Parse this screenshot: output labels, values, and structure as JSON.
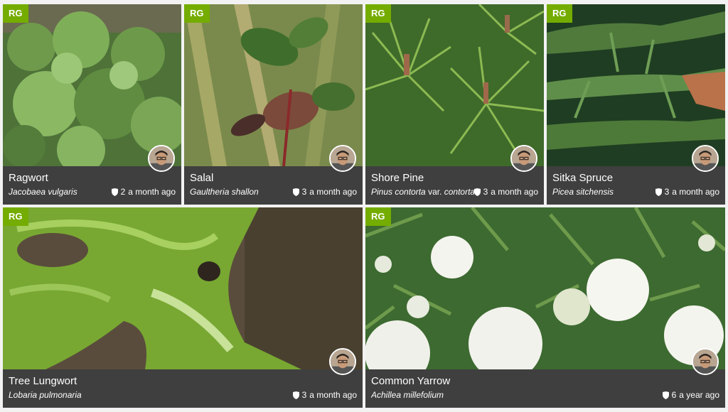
{
  "colors": {
    "badge_green": "#74ac00",
    "caption_bg": "#3f3f3f",
    "page_bg": "#f2f2f2"
  },
  "cards": [
    {
      "badge": "RG",
      "common_name": "Ragwort",
      "sci_genus_species": "Jacobaea vulgaris",
      "sci_variety_marker": "",
      "sci_variety": "",
      "id_count": "2",
      "age": "a month ago",
      "icon": "shield-icon"
    },
    {
      "badge": "RG",
      "common_name": "Salal",
      "sci_genus_species": "Gaultheria shallon",
      "sci_variety_marker": "",
      "sci_variety": "",
      "id_count": "3",
      "age": "a month ago",
      "icon": "shield-icon"
    },
    {
      "badge": "RG",
      "common_name": "Shore Pine",
      "sci_genus_species": "Pinus contorta",
      "sci_variety_marker": "var.",
      "sci_variety": "contorta",
      "id_count": "3",
      "age": "a month ago",
      "icon": "shield-icon"
    },
    {
      "badge": "RG",
      "common_name": "Sitka Spruce",
      "sci_genus_species": "Picea sitchensis",
      "sci_variety_marker": "",
      "sci_variety": "",
      "id_count": "3",
      "age": "a month ago",
      "icon": "shield-icon"
    },
    {
      "badge": "RG",
      "common_name": "Tree Lungwort",
      "sci_genus_species": "Lobaria pulmonaria",
      "sci_variety_marker": "",
      "sci_variety": "",
      "id_count": "3",
      "age": "a month ago",
      "icon": "shield-icon"
    },
    {
      "badge": "RG",
      "common_name": "Common Yarrow",
      "sci_genus_species": "Achillea millefolium",
      "sci_variety_marker": "",
      "sci_variety": "",
      "id_count": "6",
      "age": "a year ago",
      "icon": "shield-icon"
    }
  ]
}
